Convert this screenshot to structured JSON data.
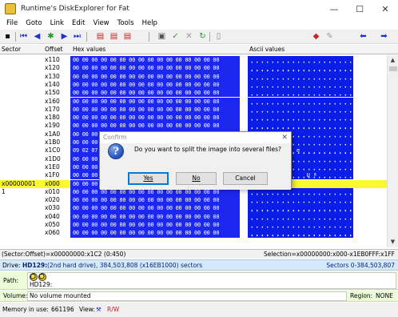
{
  "window": {
    "title": "Runtime's DiskExplorer for Fat",
    "minimize": "—",
    "maximize": "☐",
    "close": "✕"
  },
  "menu": [
    "File",
    "Goto",
    "Link",
    "Edit",
    "View",
    "Tools",
    "Help"
  ],
  "columns": {
    "sector": "Sector",
    "offset": "Offset",
    "hex": "Hex values",
    "ascii": "Ascii values"
  },
  "rows": [
    {
      "sector": "",
      "offset": "x110",
      "hex": "00 00 00 00 00 00 00 00 00 00 00 00 00 00 00 00",
      "ascii": ""
    },
    {
      "sector": "",
      "offset": "x120",
      "hex": "00 00 00 00 00 00 00 00 00 00 00 00 00 00 00 00",
      "ascii": ""
    },
    {
      "sector": "",
      "offset": "x130",
      "hex": "00 00 00 00 00 00 00 00 00 00 00 00 00 00 00 00",
      "ascii": ""
    },
    {
      "sector": "",
      "offset": "x140",
      "hex": "00 00 00 00 00 00 00 00 00 00 00 00 00 00 00 00",
      "ascii": ""
    },
    {
      "sector": "",
      "offset": "x150",
      "hex": "00 00 00 00 00 00 00 00 00 00 00 00 00 00 00 00",
      "ascii": ""
    },
    {
      "sector": "",
      "offset": "x160",
      "hex": "00 00 00 00 00 00 00 00 00 00 00 00 00 00 00 00",
      "ascii": ""
    },
    {
      "sector": "",
      "offset": "x170",
      "hex": "00 00 00 00 00 00 00 00 00 00 00 00 00 00 00 00",
      "ascii": ""
    },
    {
      "sector": "",
      "offset": "x180",
      "hex": "00 00 00 00 00 00 00 00 00 00 00 00 00 00 00 00",
      "ascii": ""
    },
    {
      "sector": "",
      "offset": "x190",
      "hex": "00 00 00 00 00 00 00 00 00 00 00 00 00 00 00 00",
      "ascii": ""
    },
    {
      "sector": "",
      "offset": "x1A0",
      "hex": "00 00 00 00 00 00 00 00 00 00 00 00 00 00 00 00",
      "ascii": ""
    },
    {
      "sector": "",
      "offset": "x1B0",
      "hex": "00 00 00 00 00 00 00 00 00 00 00 00 00 00 00 00",
      "ascii": "    \"  $ I  ."
    },
    {
      "sector": "",
      "offset": "x1C0",
      "hex": "09 02 07",
      "ascii": "  €           e"
    },
    {
      "sector": "",
      "offset": "x1D0",
      "hex": "00 00 00",
      "ascii": ""
    },
    {
      "sector": "",
      "offset": "x1E0",
      "hex": "00 00 00",
      "ascii": ""
    },
    {
      "sector": "",
      "offset": "x1F0",
      "hex": "00 00 00",
      "ascii": "                 U ª"
    },
    {
      "sector": "x00000001",
      "offset": "x000",
      "hex": "00 00 00 00 00 00 00 00 00 00 00 00 00 00 00 00",
      "ascii": ""
    },
    {
      "sector": "1",
      "offset": "x010",
      "hex": "00 00 00 00 00 00 00 00 00 00 00 00 00 00 00 00",
      "ascii": ""
    },
    {
      "sector": "",
      "offset": "x020",
      "hex": "00 00 00 00 00 00 00 00 00 00 00 00 00 00 00 00",
      "ascii": ""
    },
    {
      "sector": "",
      "offset": "x030",
      "hex": "00 00 00 00 00 00 00 00 00 00 00 00 00 00 00 00",
      "ascii": ""
    },
    {
      "sector": "",
      "offset": "x040",
      "hex": "00 00 00 00 00 00 00 00 00 00 00 00 00 00 00 00",
      "ascii": ""
    },
    {
      "sector": "",
      "offset": "x050",
      "hex": "00 00 00 00 00 00 00 00 00 00 00 00 00 00 00 00",
      "ascii": ""
    },
    {
      "sector": "",
      "offset": "x060",
      "hex": "00 00 00 00 00 00 00 00 00 00 00 00 00 00 00 00",
      "ascii": ""
    }
  ],
  "status": {
    "position": "(Sector:Offset)=x00000000:x1C2 (0:450)",
    "selection": "Selection=x00000000:x000-x1EB0FFF:x1FF"
  },
  "drive": {
    "label": "Drive:",
    "name": "HD129:",
    "desc": "(2nd hard drive), 384,503,808 (x16EB1000) sectors",
    "sectors": "Sectors 0-384,503,807"
  },
  "path": {
    "label": "Path:",
    "value": "HD129:"
  },
  "volume": {
    "label": "Volume:",
    "value": "No volume mounted",
    "region_label": "Region:",
    "region_value": "NONE"
  },
  "memory": {
    "label": "Memory in use:",
    "value": "661196",
    "view_label": "View:",
    "rw": "R/W"
  },
  "dialog": {
    "title": "Confirm",
    "close": "✕",
    "icon": "?",
    "message": "Do you want to split the image into several files?",
    "yes": "Yes",
    "no": "No",
    "cancel": "Cancel"
  },
  "toolbar_icons": [
    "save-icon",
    "first-icon",
    "prev-icon",
    "run-icon",
    "next-icon",
    "last-icon",
    "copy-icon",
    "paste-icon",
    "cut-icon",
    "tools-icon",
    "check-icon",
    "cancel-icon",
    "refresh-icon",
    "preview-icon",
    "marker-icon",
    "pin-icon",
    "back-icon",
    "forward-icon"
  ],
  "colors": {
    "hex_bg": "#1c28f0",
    "ascii_bg": "#0a1ee8",
    "highlight": "#fbf730",
    "drive_bar": "#d4eafc",
    "path_bar": "#ecfcd8"
  }
}
